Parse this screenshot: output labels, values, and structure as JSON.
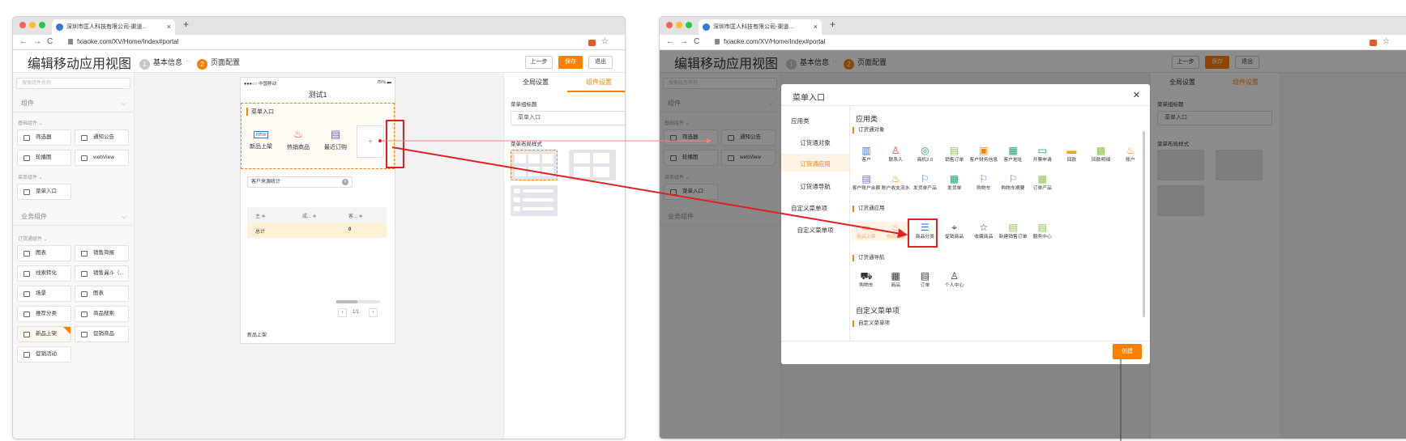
{
  "browser": {
    "tab_title": "深圳市匡人科技有限公司-渠道...",
    "new_tab": "+",
    "url": "fxiaoke.com/XV/Home/Index#portal",
    "nav": {
      "back": "←",
      "forward": "→",
      "reload": "C"
    },
    "bookmark": "☆"
  },
  "app": {
    "title": "编辑移动应用视图",
    "steps": [
      {
        "num": "1",
        "label": "基本信息"
      },
      {
        "num": "2",
        "label": "页面配置"
      }
    ],
    "step_sep": "··",
    "buttons": {
      "prev": "上一步",
      "save": "保存",
      "exit": "退出"
    }
  },
  "sidebar": {
    "search_placeholder": "搜索组件名称",
    "section_components": "组件",
    "sub_basic": "基础组件 ⌄",
    "basic_items": [
      "筛选器",
      "通知公告",
      "轮播图",
      "webView"
    ],
    "sub_menu": "菜单组件 ⌄",
    "menu_items": [
      "菜单入口"
    ],
    "section_business": "业务组件",
    "sub_order": "订货通组件 ⌄",
    "order_items": [
      "图表",
      "销售简报",
      "线索转化",
      "销售漏斗（...",
      "场景",
      "图表",
      "推荐分类",
      "商品搜索",
      "新品上架",
      "促销商品",
      "促销活动"
    ],
    "chevron": "⌵"
  },
  "phone": {
    "status_left": "●●●○○ 中国移动 ",
    "status_right": "75% ▬",
    "title": "测试1",
    "menu_section": "菜单入口",
    "menu_icons": [
      {
        "icon": "new",
        "label": "新品上架"
      },
      {
        "icon": "♨",
        "label": "热销商品"
      },
      {
        "icon": "▤",
        "label": "最近订购"
      }
    ],
    "add": "+",
    "filter_label": "客户来源统计",
    "table_headers": [
      "主 ≑",
      "成... ≑",
      "客... ≑"
    ],
    "total_label": "总计",
    "total_value": "0",
    "pagination": "1/1",
    "footer_label": "新品上架"
  },
  "right_panel": {
    "tabs": [
      "全局设置",
      "组件设置"
    ],
    "title_label": "菜单组标题",
    "title_value": "菜单入口",
    "layout_label": "菜单布局样式"
  },
  "modal": {
    "title": "菜单入口",
    "close": "✕",
    "left_nav": {
      "group1": "应用类",
      "items1": [
        "订货通对象",
        "订货通应用",
        "订货通导航"
      ],
      "group2": "自定义菜单项",
      "items2": [
        "自定义菜单项"
      ]
    },
    "section1_title": "应用类",
    "sub_objects": "订货通对象",
    "objects": [
      "客户",
      "联系人",
      "商机2.0",
      "销售订单",
      "客户财务信息",
      "客户地址",
      "开票申请",
      "回款",
      "回款明细",
      "账户",
      "客户账户余额",
      "账户收支流水",
      "发货单产品",
      "发货单",
      "购物车",
      "购物车摘要",
      "订单产品"
    ],
    "sub_apps": "订货通应用",
    "apps": [
      "新品上架",
      "热销商品",
      "商品分类",
      "促销商品",
      "收藏商品",
      "新建销售订单",
      "服务中心"
    ],
    "sub_nav": "订货通导航",
    "navs": [
      "购物车",
      "商品",
      "订单",
      "个人中心"
    ],
    "section2_title": "自定义菜单项",
    "sub_custom": "自定义菜单项",
    "create_button": "创建"
  },
  "colors": {
    "accent": "#ff8000",
    "annotation_red": "#e02020",
    "link_blue": "#2f7bd6"
  }
}
